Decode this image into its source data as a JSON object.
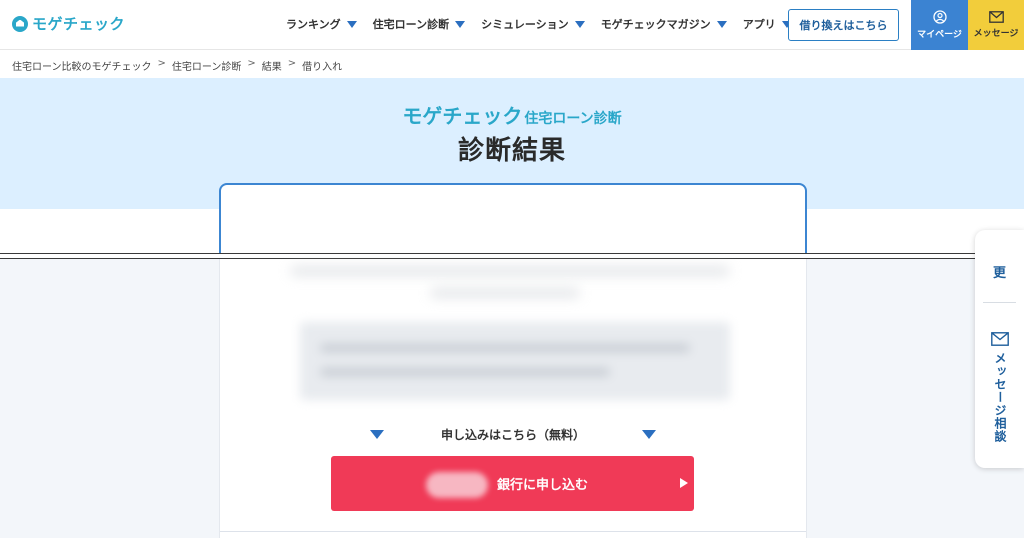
{
  "header": {
    "logo_text": "モゲチェック",
    "nav": [
      {
        "label": "ランキング"
      },
      {
        "label": "住宅ローン診断"
      },
      {
        "label": "シミュレーション"
      },
      {
        "label": "モゲチェックマガジン"
      },
      {
        "label": "アプリ"
      }
    ],
    "refinance_button": "借り換えはこちら",
    "mypage_label": "マイページ",
    "message_label": "メッセージ"
  },
  "breadcrumb": [
    "住宅ローン比較のモゲチェック",
    "住宅ローン診断",
    "結果",
    "借り入れ"
  ],
  "hero": {
    "brand": "モゲチェック",
    "subtitle": "住宅ローン診断",
    "title": "診断結果"
  },
  "apply": {
    "label": "申し込みはこちら（無料）",
    "cta_label": "銀行に申し込む"
  },
  "side_panel": {
    "top_char": "更",
    "vertical_label": "メッセージ相談"
  },
  "colors": {
    "brand": "#2aa7c9",
    "accent_blue": "#3b83d2",
    "message_yellow": "#f2cd3b",
    "cta_red": "#f03a57",
    "hero_bg": "#dcefff"
  }
}
